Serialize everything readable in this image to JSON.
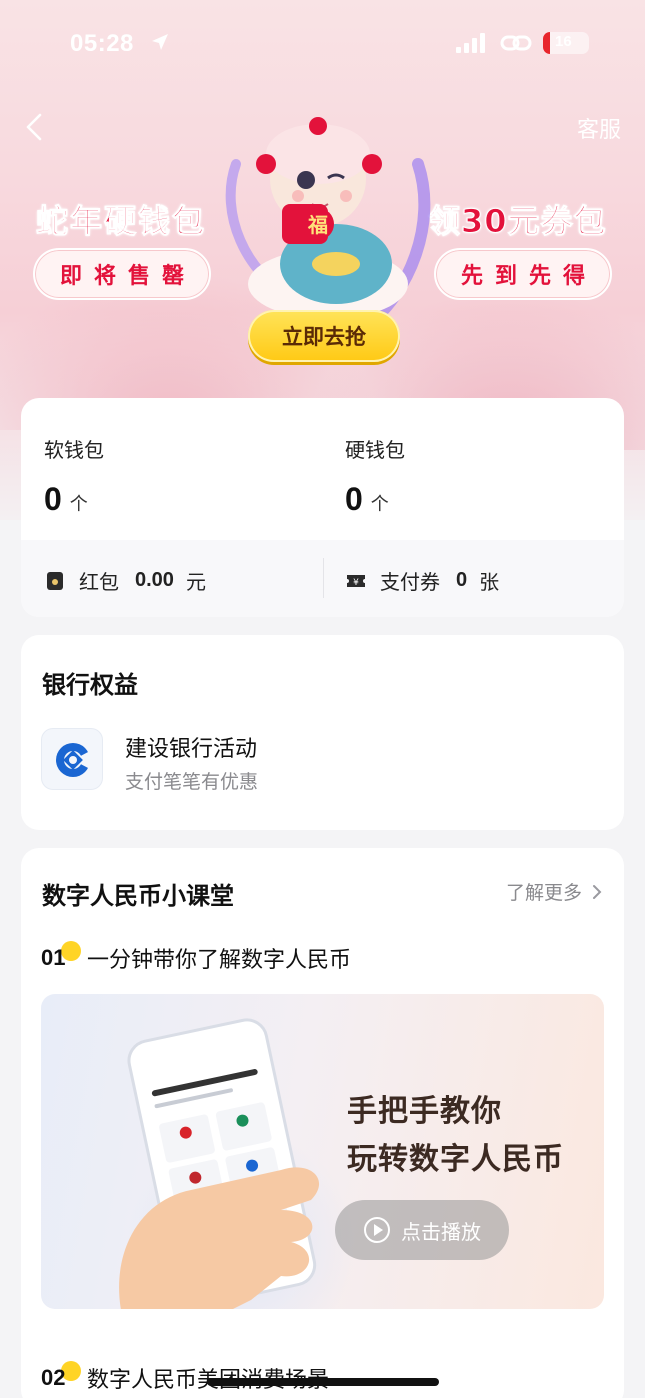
{
  "status_bar": {
    "time": "05:28",
    "battery": "16",
    "battery_level_percent": 16
  },
  "header": {
    "back_icon": "chevron-left-icon",
    "service_label": "客服"
  },
  "promo": {
    "left_title": "蛇年硬钱包",
    "left_pill": "即将售罄",
    "right_title": "领30元券包",
    "right_pill": "先到先得",
    "cta_label": "立即去抢",
    "mascot_badge": "福"
  },
  "wallet": {
    "soft": {
      "label": "软钱包",
      "count": "0",
      "unit": "个"
    },
    "hard": {
      "label": "硬钱包",
      "count": "0",
      "unit": "个"
    },
    "red_packet": {
      "label": "红包",
      "value": "0.00",
      "unit": "元"
    },
    "coupon": {
      "label": "支付券",
      "value": "0",
      "unit": "张"
    }
  },
  "bank_rights": {
    "title": "银行权益",
    "item": {
      "name": "建设银行活动",
      "desc": "支付笔笔有优惠"
    }
  },
  "digital_class": {
    "title": "数字人民币小课堂",
    "more_label": "了解更多",
    "lessons": [
      {
        "num": "01",
        "title": "一分钟带你了解数字人民币"
      },
      {
        "num": "02",
        "title": "数字人民币美团消费场景"
      }
    ],
    "video": {
      "line1": "手把手教你",
      "line2": "玩转数字人民币",
      "play_label": "点击播放"
    }
  },
  "colors": {
    "brand_red": "#e3123b",
    "cta_yellow": "#ffc914",
    "page_bg": "#f4f4f6"
  }
}
